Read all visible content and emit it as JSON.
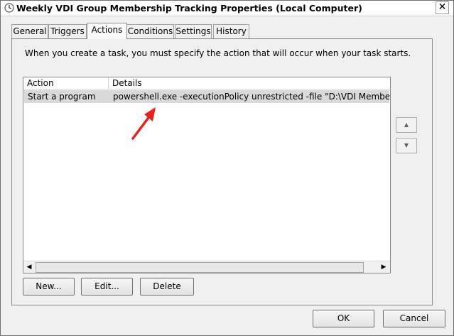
{
  "window": {
    "title": "Weekly VDI Group Membership Tracking Properties (Local Computer)",
    "close_label": "✕"
  },
  "tabs": [
    {
      "label": "General"
    },
    {
      "label": "Triggers"
    },
    {
      "label": "Actions",
      "active": true
    },
    {
      "label": "Conditions"
    },
    {
      "label": "Settings"
    },
    {
      "label": "History"
    }
  ],
  "actions_tab": {
    "intro_text": "When you create a task, you must specify the action that will occur when your task starts.",
    "list": {
      "columns": [
        "Action",
        "Details"
      ],
      "rows": [
        {
          "action": "Start a program",
          "details": "powershell.exe -executionPolicy unrestricted -file \"D:\\VDI Membership Tra"
        }
      ]
    },
    "move_up_icon": "triangle-up",
    "move_down_icon": "triangle-down",
    "buttons": {
      "new": "New...",
      "edit": "Edit...",
      "delete": "Delete"
    }
  },
  "footer": {
    "ok": "OK",
    "cancel": "Cancel"
  },
  "colors": {
    "annotation_arrow": "#e8211c",
    "selected_row": "#d9d9d9"
  }
}
